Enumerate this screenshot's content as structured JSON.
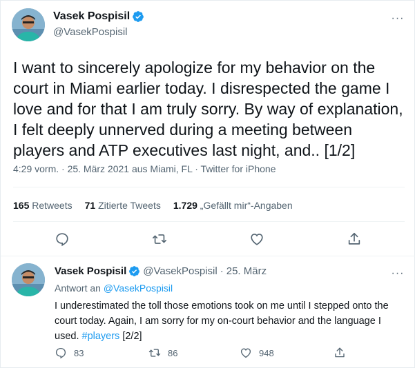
{
  "tweet": {
    "author_name": "Vasek Pospisil",
    "handle": "@VasekPospisil",
    "text": "I want to sincerely apologize for my behavior on the court in Miami earlier today. I disrespected the game I love and for that I am truly sorry. By way of explanation, I felt deeply unnerved during a meeting between players and ATP executives last night, and.. [1/2]",
    "meta": "4:29 vorm. · 25. März 2021 aus Miami, FL · Twitter for iPhone",
    "retweets_count": "165",
    "retweets_label": "Retweets",
    "quotes_count": "71",
    "quotes_label": "Zitierte Tweets",
    "likes_count": "1.729",
    "likes_label": "„Gefällt mir“-Angaben",
    "more_icon": "···"
  },
  "reply": {
    "author_name": "Vasek Pospisil",
    "handle": "@VasekPospisil",
    "dot": "·",
    "date": "25. März",
    "reply_prefix": "Antwort an",
    "reply_to": "@VasekPospisil",
    "text_before": "I underestimated the toll those emotions took on me until I stepped onto the court today. Again, I am sorry for my on-court behavior and the language I used. ",
    "hashtag": "#players",
    "text_after": " [2/2]",
    "reply_count": "83",
    "retweet_count": "86",
    "like_count": "948",
    "more_icon": "···"
  },
  "colors": {
    "accent": "#1d9bf0",
    "text": "#0f1419",
    "secondary": "#536471",
    "divider": "#eff3f4"
  },
  "icons": [
    "verified-badge-icon",
    "more-icon",
    "reply-icon",
    "retweet-icon",
    "like-icon",
    "share-icon"
  ]
}
